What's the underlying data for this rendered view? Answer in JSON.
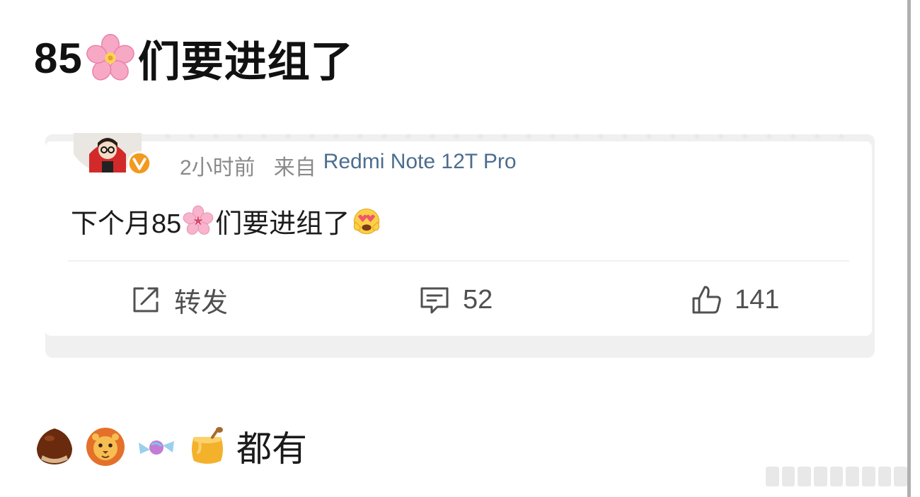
{
  "headline": {
    "prefix": "85",
    "emoji": "cherry-blossom-emoji",
    "text": "们要进组了"
  },
  "post": {
    "verified_badge": "v",
    "time": "2小时前",
    "source_prefix": "来自",
    "device": "Redmi Note 12T Pro",
    "text_part1": "下个月85",
    "text_part2": "们要进组了",
    "emojis": [
      "cherry-blossom-emoji",
      "heart-eyes-emoji"
    ],
    "actions": {
      "repost_label": "转发",
      "comment_count": "52",
      "like_count": "141"
    }
  },
  "footer": {
    "emojis": [
      "chestnut-emoji",
      "lion-emoji",
      "candy-emoji",
      "honey-pot-emoji"
    ],
    "text": "都有"
  },
  "colors": {
    "device_link": "#4d6d8f",
    "verified_badge": "#f29a1f",
    "muted_text": "#8a8a8a"
  }
}
